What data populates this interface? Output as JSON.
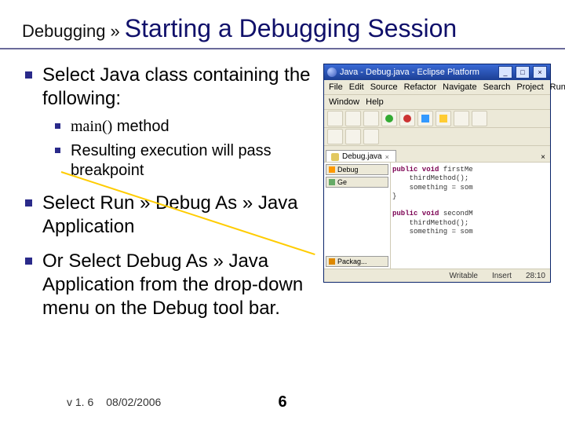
{
  "breadcrumb": "Debugging  »",
  "title": "Starting a Debugging Session",
  "bullets": {
    "b1": "Select Java class containing the following:",
    "b1_sub1_mono": "main()",
    "b1_sub1_rest": " method",
    "b1_sub2": "Resulting execution will pass breakpoint",
    "b2": "Select Run » Debug As » Java Application",
    "b3": "Or Select Debug As » Java Application from the drop-down menu on the Debug tool bar."
  },
  "shot": {
    "title": "Java - Debug.java - Eclipse Platform",
    "menu": {
      "file": "File",
      "edit": "Edit",
      "source": "Source",
      "refactor": "Refactor",
      "navigate": "Navigate",
      "search": "Search",
      "project": "Project",
      "run": "Run",
      "window": "Window",
      "help": "Help"
    },
    "tab": "Debug.java",
    "side": {
      "debug": "Debug",
      "ge": "Ge",
      "packages": "Packag..."
    },
    "code_lines": [
      "public void firstMe",
      "    thirdMethod();",
      "    something = som",
      "}",
      "",
      "public void secondM",
      "    thirdMethod();",
      "    something = som"
    ],
    "status": {
      "writable": "Writable",
      "insert": "Insert",
      "pos": "28:10"
    }
  },
  "footer": {
    "version": "v 1. 6",
    "date": "08/02/2006",
    "page": "6"
  }
}
